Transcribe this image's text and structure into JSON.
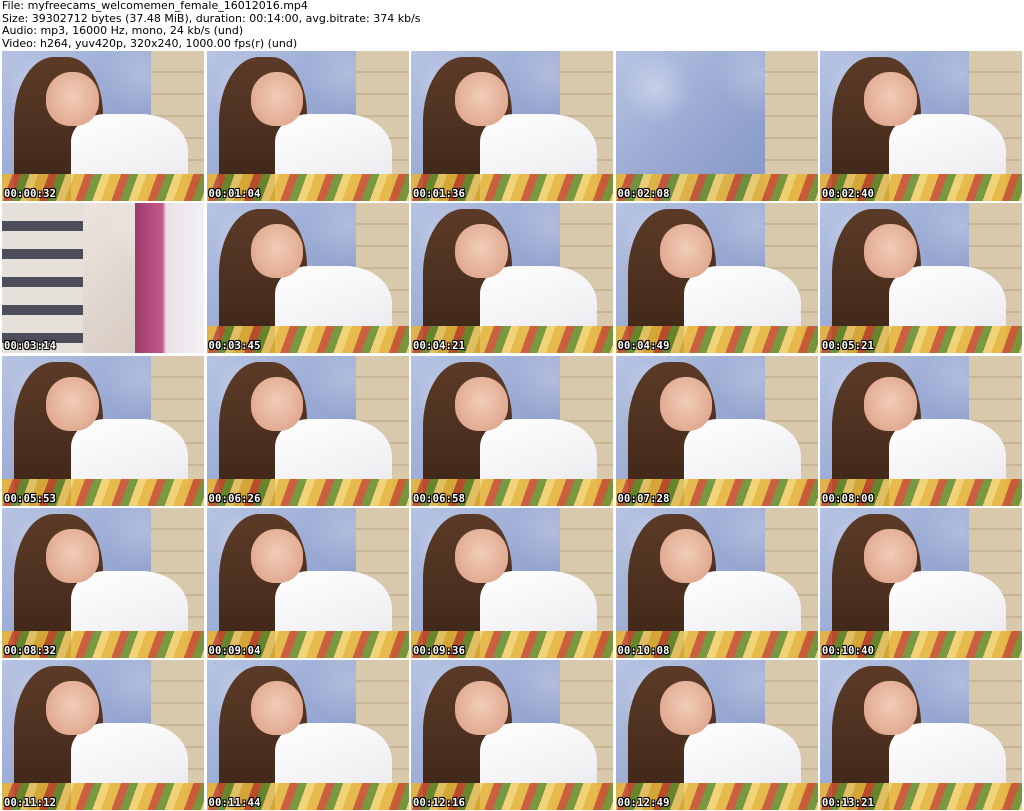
{
  "header": {
    "file": "File: myfreecams_welcomemen_female_16012016.mp4",
    "size": "Size: 39302712 bytes (37.48 MiB), duration: 00:14:00, avg.bitrate: 374 kb/s",
    "audio": "Audio: mp3, 16000 Hz, mono, 24 kb/s (und)",
    "video": "Video: h264, yuv420p, 320x240, 1000.00 fps(r) (und)"
  },
  "thumbnails": [
    {
      "time": "00:00:32",
      "variant": "person"
    },
    {
      "time": "00:01:04",
      "variant": "person"
    },
    {
      "time": "00:01:36",
      "variant": "person"
    },
    {
      "time": "00:02:08",
      "variant": "wall"
    },
    {
      "time": "00:02:40",
      "variant": "person"
    },
    {
      "time": "00:03:14",
      "variant": "door"
    },
    {
      "time": "00:03:45",
      "variant": "person"
    },
    {
      "time": "00:04:21",
      "variant": "person"
    },
    {
      "time": "00:04:49",
      "variant": "person"
    },
    {
      "time": "00:05:21",
      "variant": "person"
    },
    {
      "time": "00:05:53",
      "variant": "person"
    },
    {
      "time": "00:06:26",
      "variant": "person"
    },
    {
      "time": "00:06:58",
      "variant": "person"
    },
    {
      "time": "00:07:28",
      "variant": "person"
    },
    {
      "time": "00:08:00",
      "variant": "person"
    },
    {
      "time": "00:08:32",
      "variant": "person"
    },
    {
      "time": "00:09:04",
      "variant": "person"
    },
    {
      "time": "00:09:36",
      "variant": "person"
    },
    {
      "time": "00:10:08",
      "variant": "person"
    },
    {
      "time": "00:10:40",
      "variant": "person"
    },
    {
      "time": "00:11:12",
      "variant": "person"
    },
    {
      "time": "00:11:44",
      "variant": "person"
    },
    {
      "time": "00:12:16",
      "variant": "person"
    },
    {
      "time": "00:12:49",
      "variant": "person"
    },
    {
      "time": "00:13:21",
      "variant": "person"
    }
  ]
}
